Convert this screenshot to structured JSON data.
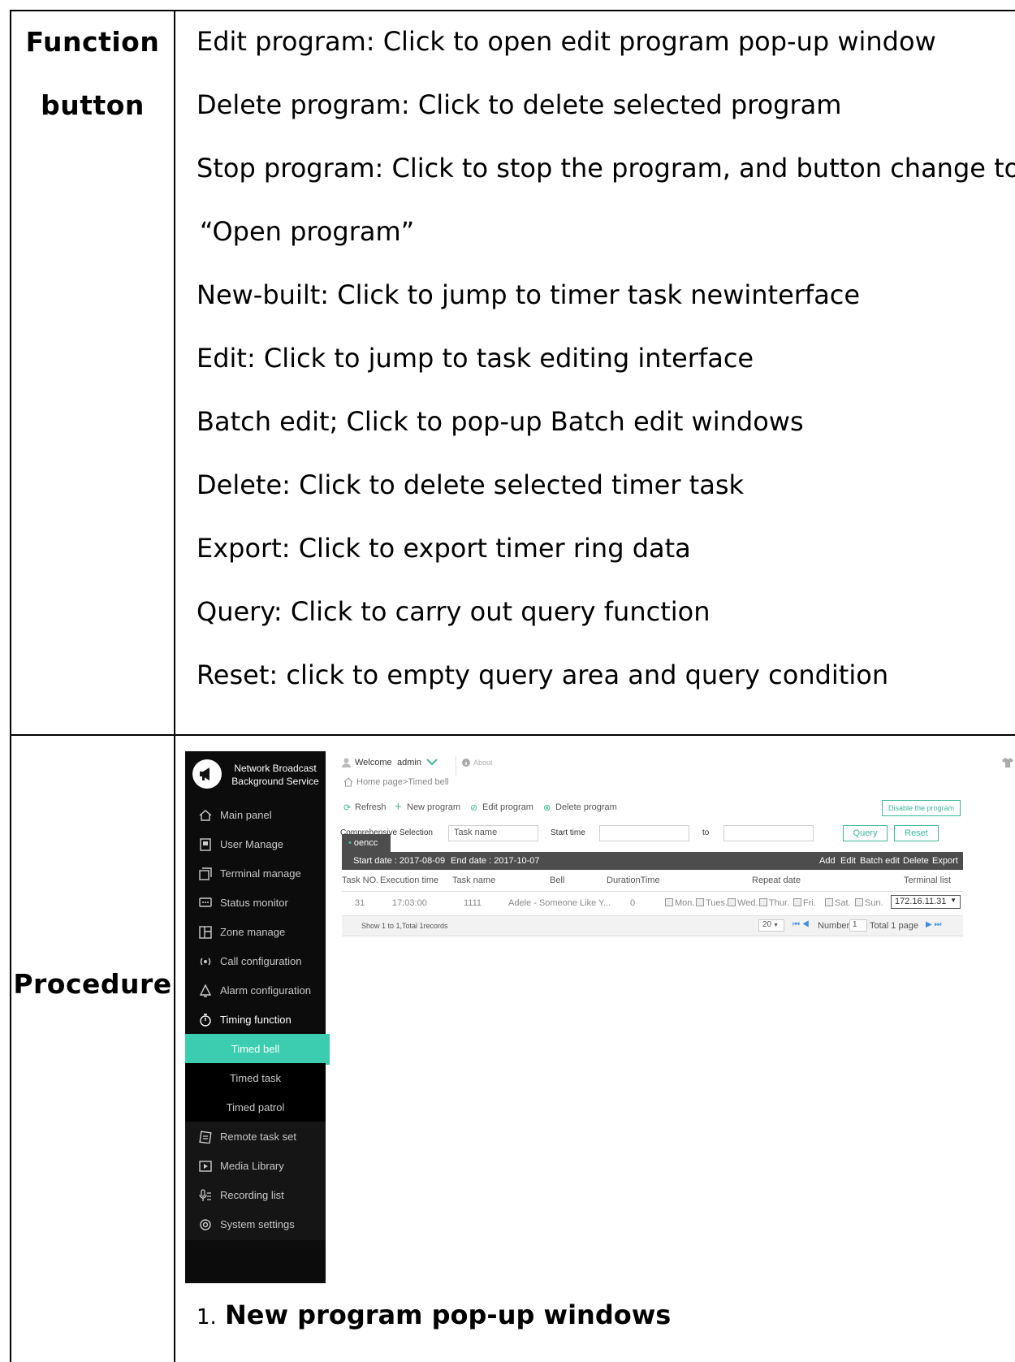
{
  "table": {
    "function_label_1": "Function",
    "function_label_2": "button",
    "procedure_label": "Procedure",
    "lines": [
      "Edit program: Click to open edit program pop-up window",
      "Delete program: Click to delete selected program",
      "Stop program: Click to stop the program, and button change to",
      "“Open program”",
      "New-built: Click to jump to timer task newinterface",
      "Edit: Click to jump to task editing interface",
      "Batch edit; Click to pop-up Batch edit windows",
      "Delete: Click to delete selected timer task",
      "Export: Click to export timer ring data",
      "Query: Click to carry out query function",
      "Reset: click to empty query area and query condition"
    ],
    "step_number": "1.",
    "step_title": "New program pop-up windows"
  },
  "screenshot": {
    "brand_line1": "Network Broadcast",
    "brand_line2": "Background Service",
    "nav": [
      "Main panel",
      "User Manage",
      "Terminal manage",
      "Status monitor",
      "Zone manage",
      "Call configuration",
      "Alarm configuration",
      "Timing function"
    ],
    "sub_nav": [
      "Timed bell",
      "Timed task",
      "Timed patrol"
    ],
    "nav_bottom": [
      "Remote task set",
      "Media Library",
      "Recording list",
      "System settings"
    ],
    "welcome": "Welcome",
    "user": "admin",
    "about": "About",
    "breadcrumb": "Home page>Timed bell",
    "toolbar": {
      "refresh": "Refresh",
      "new_program": "New program",
      "edit_program": "Edit program",
      "delete_program": "Delete program",
      "disable": "Disable the program"
    },
    "filter": {
      "label": "Comprehensive Selection",
      "task_placeholder": "Task name",
      "start_time": "Start time",
      "to": "to",
      "query": "Query",
      "reset": "Reset"
    },
    "tab_name": "oencc",
    "start_date": "Start date : 2017-08-09",
    "end_date": "End date : 2017-10-07",
    "actions": [
      "Add",
      "Edit",
      "Batch edit",
      "Delete",
      "Export"
    ],
    "columns": [
      "Task NO.",
      "Execution time",
      "Task name",
      "Bell",
      "DurationTime",
      "Repeat date",
      "Terminal list"
    ],
    "row": {
      "no": "31",
      "time": "17:03:00",
      "name": "1111",
      "bell": "Adele - Someone Like Y...",
      "duration": "0",
      "days": [
        "Mon.",
        "Tues.",
        "Wed.",
        "Thur.",
        "Fri.",
        "Sat.",
        "Sun."
      ],
      "terminal": "172.16.11.31"
    },
    "footer": {
      "show": "Show 1 to 1,Total 1records",
      "page_size": "20",
      "number_label": "Number",
      "page_no": "1",
      "total": "Total 1 page"
    }
  }
}
